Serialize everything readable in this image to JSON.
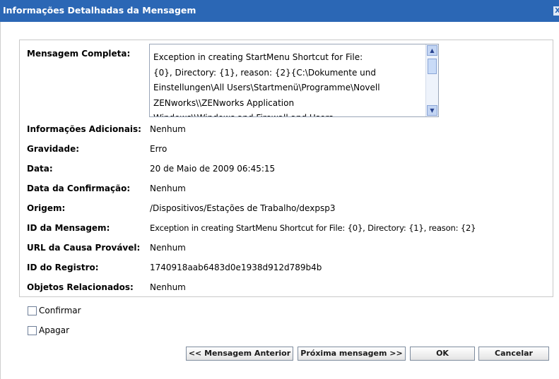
{
  "dialog": {
    "title": "Informações Detalhadas da Mensagem",
    "close_glyph": "X"
  },
  "fields": {
    "full_message": {
      "label": "Mensagem Completa:",
      "value": "Exception in creating StartMenu Shortcut for File:\n{0}, Directory: {1}, reason: {2}{C:\\Dokumente und\nEinstellungen\\All Users\\Startmenü\\Programme\\Novell\nZENworks\\\\ZENworks Application\nWindows\\\\Windows and Firewall and Users"
    },
    "additional_info": {
      "label": "Informações Adicionais:",
      "value": "Nenhum"
    },
    "severity": {
      "label": "Gravidade:",
      "value": "Erro"
    },
    "date": {
      "label": "Data:",
      "value": "20 de Maio de 2009 06:45:15"
    },
    "ack_date": {
      "label": "Data da Confirmação:",
      "value": "Nenhum"
    },
    "origin": {
      "label": "Origem:",
      "value": "/Dispositivos/Estações de Trabalho/dexpsp3"
    },
    "message_id": {
      "label": "ID da Mensagem:",
      "value": "Exception in creating StartMenu Shortcut for File: {0}, Directory: {1}, reason: {2}"
    },
    "probable_cause_url": {
      "label": "URL da Causa Provável:",
      "value": "Nenhum"
    },
    "log_id": {
      "label": "ID do Registro:",
      "value": "1740918aab6483d0e1938d912d789b4b"
    },
    "related_objects": {
      "label": "Objetos Relacionados:",
      "value": "Nenhum"
    }
  },
  "options": {
    "confirm": {
      "label": "Confirmar",
      "checked": false
    },
    "delete": {
      "label": "Apagar",
      "checked": false
    }
  },
  "buttons": {
    "previous": "<< Mensagem Anterior",
    "next": "Próxima mensagem >>",
    "ok": "OK",
    "cancel": "Cancelar"
  },
  "colors": {
    "titlebar": "#2b67b5",
    "panel_border": "#c9c9c9"
  },
  "icons": {
    "close": "close-icon",
    "scroll_up": "scroll-up-arrow-icon",
    "scroll_down": "scroll-down-arrow-icon"
  }
}
